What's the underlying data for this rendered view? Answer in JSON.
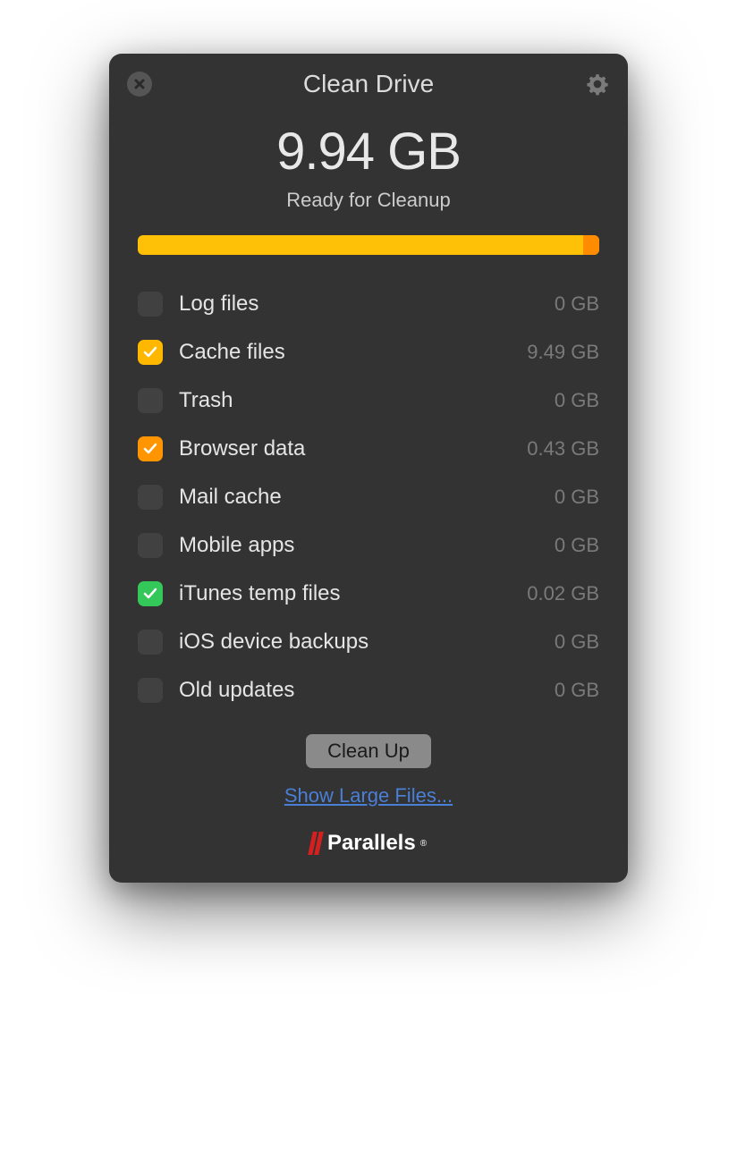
{
  "header": {
    "title": "Clean Drive"
  },
  "summary": {
    "size": "9.94 GB",
    "status": "Ready for Cleanup"
  },
  "items": [
    {
      "label": "Log files",
      "size": "0 GB",
      "checked": false,
      "color": ""
    },
    {
      "label": "Cache files",
      "size": "9.49 GB",
      "checked": true,
      "color": "yellow"
    },
    {
      "label": "Trash",
      "size": "0 GB",
      "checked": false,
      "color": ""
    },
    {
      "label": "Browser data",
      "size": "0.43 GB",
      "checked": true,
      "color": "orange"
    },
    {
      "label": "Mail cache",
      "size": "0 GB",
      "checked": false,
      "color": ""
    },
    {
      "label": "Mobile apps",
      "size": "0 GB",
      "checked": false,
      "color": ""
    },
    {
      "label": "iTunes temp files",
      "size": "0.02 GB",
      "checked": true,
      "color": "green"
    },
    {
      "label": "iOS device backups",
      "size": "0 GB",
      "checked": false,
      "color": ""
    },
    {
      "label": "Old updates",
      "size": "0 GB",
      "checked": false,
      "color": ""
    }
  ],
  "actions": {
    "cleanup_label": "Clean Up",
    "show_large_label": "Show Large Files..."
  },
  "branding": {
    "name": "Parallels"
  }
}
